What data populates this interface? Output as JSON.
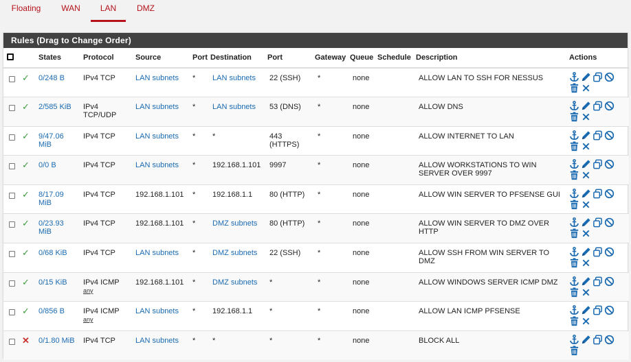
{
  "tabs": [
    {
      "label": "Floating",
      "active": false
    },
    {
      "label": "WAN",
      "active": false
    },
    {
      "label": "LAN",
      "active": true
    },
    {
      "label": "DMZ",
      "active": false
    }
  ],
  "panel": {
    "title": "Rules (Drag to Change Order)"
  },
  "columns": [
    "States",
    "Protocol",
    "Source",
    "Port",
    "Destination",
    "Port",
    "Gateway",
    "Queue",
    "Schedule",
    "Description",
    "Actions"
  ],
  "colors": {
    "accent": "#b5121b",
    "link": "#1a6ab1",
    "pass": "#3c9b3c",
    "block": "#c9302c",
    "heading": "#424242",
    "icon": "#1a6ab1"
  },
  "icons": [
    "anchor-icon",
    "pencil-icon",
    "copy-icon",
    "ban-icon",
    "trash-icon",
    "times-icon"
  ],
  "rows": [
    {
      "status": "pass",
      "status_icon": "✓",
      "states": "0/248 B",
      "protocol": "IPv4 TCP",
      "protocol_sub": "",
      "source": "LAN subnets",
      "source_link": true,
      "sport": "*",
      "dest": "LAN subnets",
      "dest_link": true,
      "dport": "22 (SSH)",
      "gateway": "*",
      "queue": "none",
      "schedule": "",
      "description": "ALLOW LAN TO SSH FOR NESSUS",
      "has_times": true
    },
    {
      "status": "pass",
      "status_icon": "✓",
      "states": "2/585 KiB",
      "protocol": "IPv4 TCP/UDP",
      "protocol_sub": "",
      "source": "LAN subnets",
      "source_link": true,
      "sport": "*",
      "dest": "LAN subnets",
      "dest_link": true,
      "dport": "53 (DNS)",
      "gateway": "*",
      "queue": "none",
      "schedule": "",
      "description": "ALLOW DNS",
      "has_times": true
    },
    {
      "status": "pass",
      "status_icon": "✓",
      "states": "9/47.06 MiB",
      "protocol": "IPv4 TCP",
      "protocol_sub": "",
      "source": "LAN subnets",
      "source_link": true,
      "sport": "*",
      "dest": "*",
      "dest_link": false,
      "dport": "443 (HTTPS)",
      "gateway": "*",
      "queue": "none",
      "schedule": "",
      "description": "ALLOW INTERNET TO LAN",
      "has_times": true
    },
    {
      "status": "pass",
      "status_icon": "✓",
      "states": "0/0 B",
      "protocol": "IPv4 TCP",
      "protocol_sub": "",
      "source": "LAN subnets",
      "source_link": true,
      "sport": "*",
      "dest": "192.168.1.101",
      "dest_link": false,
      "dport": "9997",
      "gateway": "*",
      "queue": "none",
      "schedule": "",
      "description": "ALLOW WORKSTATIONS TO WIN SERVER OVER 9997",
      "has_times": true
    },
    {
      "status": "pass",
      "status_icon": "✓",
      "states": "8/17.09 MiB",
      "protocol": "IPv4 TCP",
      "protocol_sub": "",
      "source": "192.168.1.101",
      "source_link": false,
      "sport": "*",
      "dest": "192.168.1.1",
      "dest_link": false,
      "dport": "80 (HTTP)",
      "gateway": "*",
      "queue": "none",
      "schedule": "",
      "description": "ALLOW WIN SERVER TO PFSENSE GUI",
      "has_times": true
    },
    {
      "status": "pass",
      "status_icon": "✓",
      "states": "0/23.93 MiB",
      "protocol": "IPv4 TCP",
      "protocol_sub": "",
      "source": "192.168.1.101",
      "source_link": false,
      "sport": "*",
      "dest": "DMZ subnets",
      "dest_link": true,
      "dport": "80 (HTTP)",
      "gateway": "*",
      "queue": "none",
      "schedule": "",
      "description": "ALLOW WIN SERVER TO DMZ OVER HTTP",
      "has_times": true
    },
    {
      "status": "pass",
      "status_icon": "✓",
      "states": "0/68 KiB",
      "protocol": "IPv4 TCP",
      "protocol_sub": "",
      "source": "LAN subnets",
      "source_link": true,
      "sport": "*",
      "dest": "DMZ subnets",
      "dest_link": true,
      "dport": "22 (SSH)",
      "gateway": "*",
      "queue": "none",
      "schedule": "",
      "description": "ALLOW SSH FROM WIN SERVER TO DMZ",
      "has_times": true
    },
    {
      "status": "pass",
      "status_icon": "✓",
      "states": "0/15 KiB",
      "protocol": "IPv4 ICMP",
      "protocol_sub": "any",
      "source": "192.168.1.101",
      "source_link": false,
      "sport": "*",
      "dest": "DMZ subnets",
      "dest_link": true,
      "dport": "*",
      "gateway": "*",
      "queue": "none",
      "schedule": "",
      "description": "ALLOW WINDOWS SERVER ICMP DMZ",
      "has_times": true
    },
    {
      "status": "pass",
      "status_icon": "✓",
      "states": "0/856 B",
      "protocol": "IPv4 ICMP",
      "protocol_sub": "any",
      "source": "LAN subnets",
      "source_link": true,
      "sport": "*",
      "dest": "192.168.1.1",
      "dest_link": false,
      "dport": "*",
      "gateway": "*",
      "queue": "none",
      "schedule": "",
      "description": "ALLOW LAN ICMP PFSENSE",
      "has_times": true
    },
    {
      "status": "block",
      "status_icon": "✕",
      "states": "0/1.80 MiB",
      "protocol": "IPv4 TCP",
      "protocol_sub": "",
      "source": "LAN subnets",
      "source_link": true,
      "sport": "*",
      "dest": "*",
      "dest_link": false,
      "dport": "*",
      "gateway": "*",
      "queue": "none",
      "schedule": "",
      "description": "BLOCK ALL",
      "has_times": false
    }
  ]
}
